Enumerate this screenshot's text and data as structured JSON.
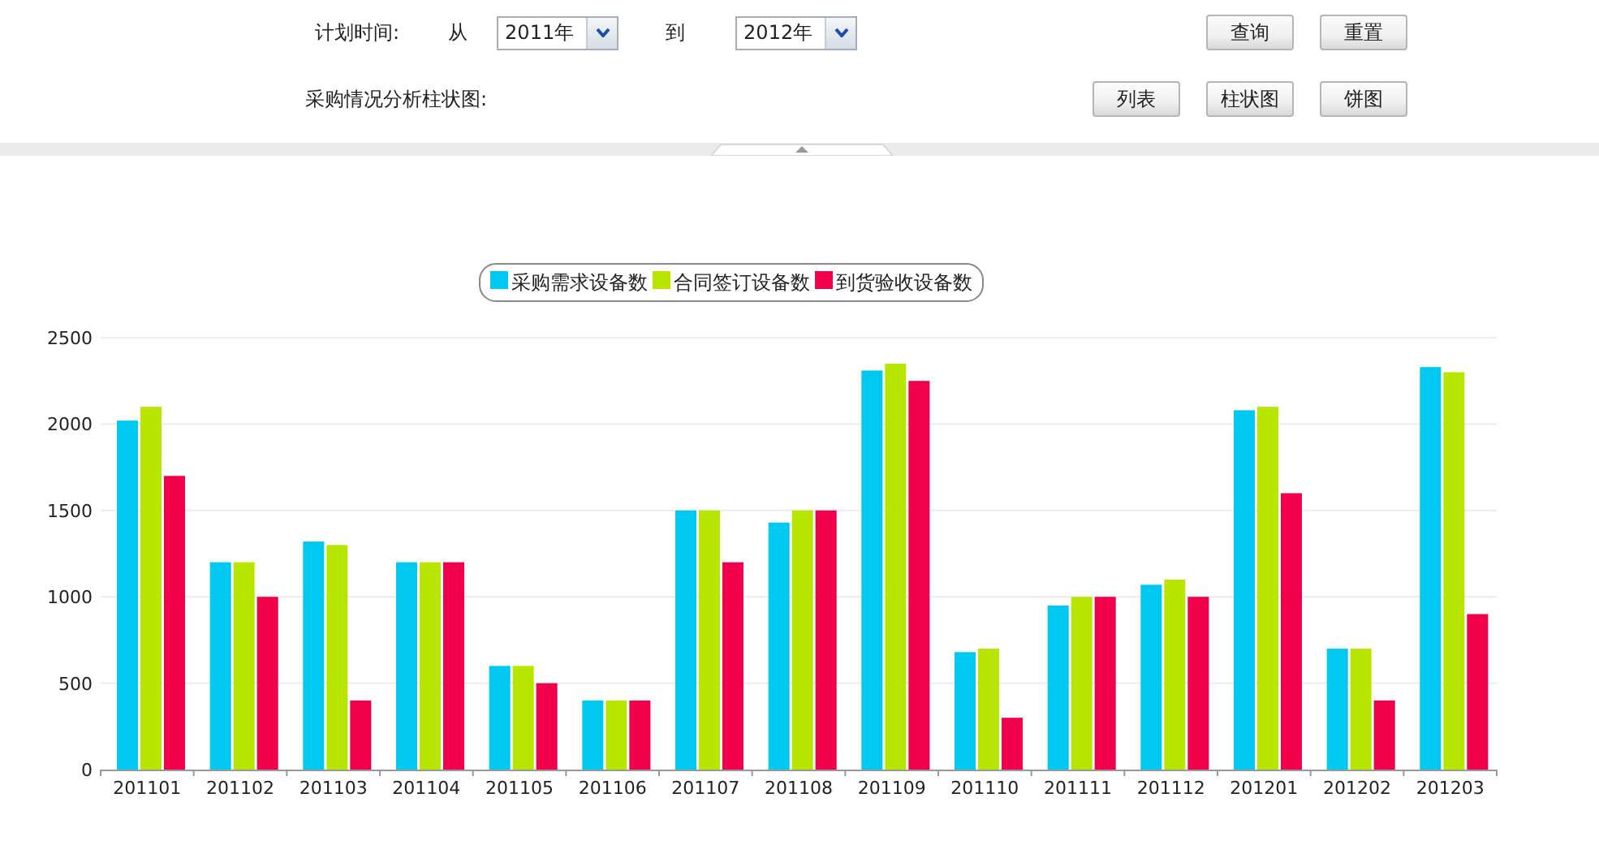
{
  "filters": {
    "label": "计划时间:",
    "from_label": "从",
    "from_value": "2011年",
    "to_label": "到",
    "to_value": "2012年",
    "buttons": [
      "查询",
      "重置"
    ]
  },
  "chart_section": {
    "title": "采购情况分析柱状图:",
    "view_buttons": [
      "列表",
      "柱状图",
      "饼图"
    ],
    "chart_data": {
      "type": "bar",
      "categories": [
        "201101",
        "201102",
        "201103",
        "201104",
        "201105",
        "201106",
        "201107",
        "201108",
        "201109",
        "201110",
        "201111",
        "201112",
        "201201",
        "201202",
        "201203"
      ],
      "series": [
        {
          "name": "采购需求设备数",
          "color": "#00c8f0",
          "values": [
            2020,
            1200,
            1320,
            1200,
            600,
            400,
            1500,
            1430,
            2310,
            680,
            950,
            1070,
            2080,
            700,
            2330
          ]
        },
        {
          "name": "合同签订设备数",
          "color": "#b8e600",
          "values": [
            2100,
            1200,
            1300,
            1200,
            600,
            400,
            1500,
            1500,
            2350,
            700,
            1000,
            1100,
            2100,
            700,
            2300
          ]
        },
        {
          "name": "到货验收设备数",
          "color": "#f0004a",
          "values": [
            1700,
            1000,
            400,
            1200,
            500,
            400,
            1200,
            1500,
            2250,
            300,
            1000,
            1000,
            1600,
            400,
            900
          ]
        }
      ],
      "grid": true,
      "legend": true,
      "ylim": [
        0,
        2500
      ],
      "yticks": [
        0,
        500,
        1000,
        1500,
        2000,
        2500
      ]
    }
  }
}
